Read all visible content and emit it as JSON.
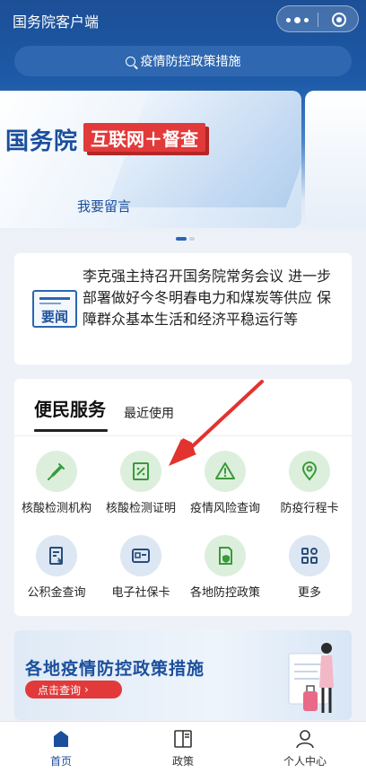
{
  "app": {
    "title": "国务院客户端"
  },
  "search": {
    "placeholder": "疫情防控政策措施"
  },
  "banner": {
    "brand": "国务院",
    "tag": "互联网＋督查",
    "cta": "我要留言"
  },
  "news": {
    "badge": "要闻",
    "text": "李克强主持召开国务院常务会议 进一步部署做好今冬明春电力和煤炭等供应 保障群众基本生活和经济平稳运行等"
  },
  "services": {
    "title": "便民服务",
    "recent": "最近使用",
    "items": [
      {
        "label": "核酸检测机构",
        "icon": "dropper-icon",
        "color": "green"
      },
      {
        "label": "核酸检测证明",
        "icon": "certificate-icon",
        "color": "green"
      },
      {
        "label": "疫情风险查询",
        "icon": "warning-icon",
        "color": "green"
      },
      {
        "label": "防疫行程卡",
        "icon": "location-pin-icon",
        "color": "green"
      },
      {
        "label": "公积金查询",
        "icon": "fund-document-icon",
        "color": "blue"
      },
      {
        "label": "电子社保卡",
        "icon": "id-card-icon",
        "color": "blue"
      },
      {
        "label": "各地防控政策",
        "icon": "shield-document-icon",
        "color": "green"
      },
      {
        "label": "更多",
        "icon": "grid-icon",
        "color": "blue"
      }
    ]
  },
  "promo": {
    "title": "各地疫情防控政策措施",
    "button": "点击查询"
  },
  "tabbar": {
    "items": [
      {
        "label": "首页",
        "icon": "home-icon",
        "active": true
      },
      {
        "label": "政策",
        "icon": "book-icon",
        "active": false
      },
      {
        "label": "个人中心",
        "icon": "person-icon",
        "active": false
      }
    ]
  },
  "colors": {
    "primary": "#1b4f9c",
    "accent": "#e23a3a",
    "green": "#3a9a3a",
    "greenBg": "#dcefdc",
    "blueBg": "#dce7f3"
  }
}
